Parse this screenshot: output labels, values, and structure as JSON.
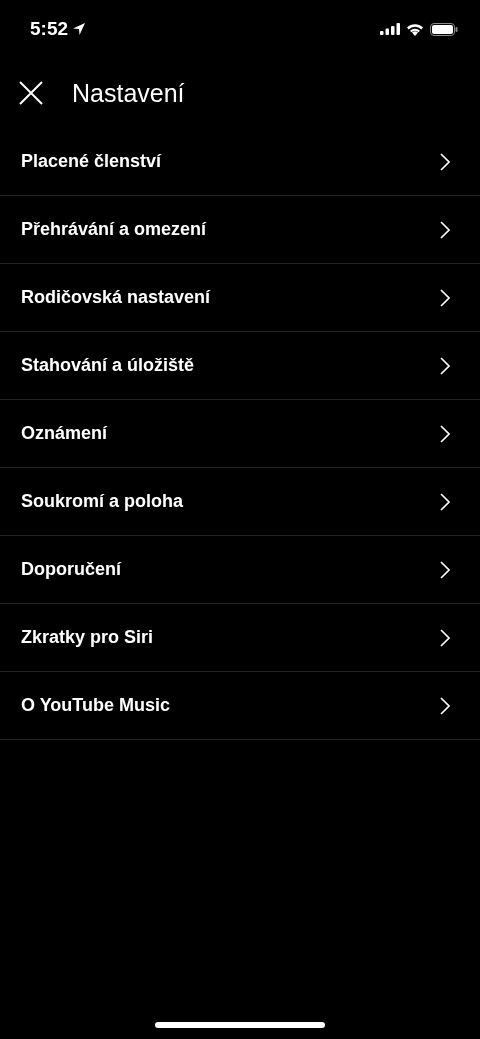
{
  "status_bar": {
    "time": "5:52"
  },
  "header": {
    "title": "Nastavení"
  },
  "items": [
    {
      "label": "Placené členství"
    },
    {
      "label": "Přehrávání a omezení"
    },
    {
      "label": "Rodičovská nastavení"
    },
    {
      "label": "Stahování a úložiště"
    },
    {
      "label": "Oznámení"
    },
    {
      "label": "Soukromí a poloha"
    },
    {
      "label": "Doporučení"
    },
    {
      "label": "Zkratky pro Siri"
    },
    {
      "label": "O YouTube Music"
    }
  ]
}
